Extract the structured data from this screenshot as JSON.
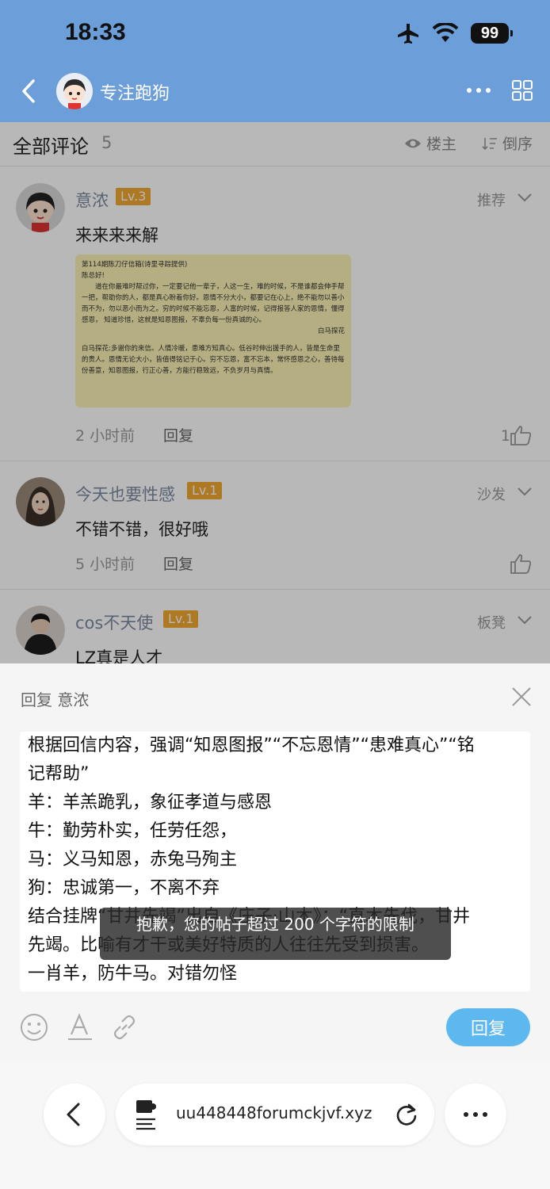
{
  "status_bar": {
    "time": "18:33",
    "battery": "99"
  },
  "header": {
    "title": "专注跑狗"
  },
  "comments_header": {
    "title": "全部评论",
    "count": "5",
    "owner_label": "楼主",
    "order_label": "倒序"
  },
  "comments": [
    {
      "name": "意浓",
      "level": "Lv.3",
      "tag": "推荐",
      "text": "来来来来解",
      "time": "2 小时前",
      "reply": "回复",
      "likes": "1",
      "image_text": {
        "title": "第114期陈刀仔信箱(诗里寻踪提供)",
        "greeting": "陈总好!",
        "body": "道在你最难时帮过你，一定要记他一辈子，人这一生，难的时候，不是谁都会伸手帮一把，帮助你的人，都是真心盼着你好。恩情不分大小，都要记在心上，绝不能勿以善小而不为，勿以恶小而为之。穷的时候不能忘恩，人富的时候，记得报答人家的恩情，懂得感恩， 知道珍惜，这就是知恩图报，不辜负每一份真诚的心。",
        "signature": "白马探花",
        "reply_body": "白马探花:多谢你的来信。人情冷暖，患难方知真心。低谷时伸出援手的人，皆是生命里的贵人。恩情无论大小，皆值得铭记于心。穷不忘恩，富不忘本，常怀感恩之心，善待每份善意，知恩图报，行正心善，方能行稳致远，不负岁月与真情。"
      }
    },
    {
      "name": "今天也要性感",
      "level": "Lv.1",
      "tag": "沙发",
      "text": "不错不错，很好哦",
      "time": "5 小时前",
      "reply": "回复"
    },
    {
      "name": "cos不天使",
      "level": "Lv.1",
      "tag": "板凳",
      "text": "LZ真是人才"
    }
  ],
  "reply_panel": {
    "title": "回复 意浓",
    "lines": [
      "根据回信内容，强调“知恩图报”“不忘恩情”“患难真心”“铭",
      "记帮助”",
      "羊：羊羔跪乳，象征孝道与感恩",
      "牛：勤劳朴实，任劳任怨，",
      "马：义马知恩，赤兔马殉主",
      "狗：忠诚第一，不离不弃",
      "结合挂牌“甘井先竭”出自《庄子·山木》：“直木先伐，甘井",
      "先竭。比喻有才干或美好特质的人往往先受到损害。",
      "一肖羊，防牛马。对错勿怪"
    ],
    "toast": "抱歉，您的帖子超过 200 个字符的限制",
    "button": "回复"
  },
  "browser": {
    "url": "uu448448forumckjvf.xyz"
  },
  "colors": {
    "header_bg": "#6c9fd9",
    "level_badge": "#f0a830",
    "reply_button": "#5db8f0"
  }
}
